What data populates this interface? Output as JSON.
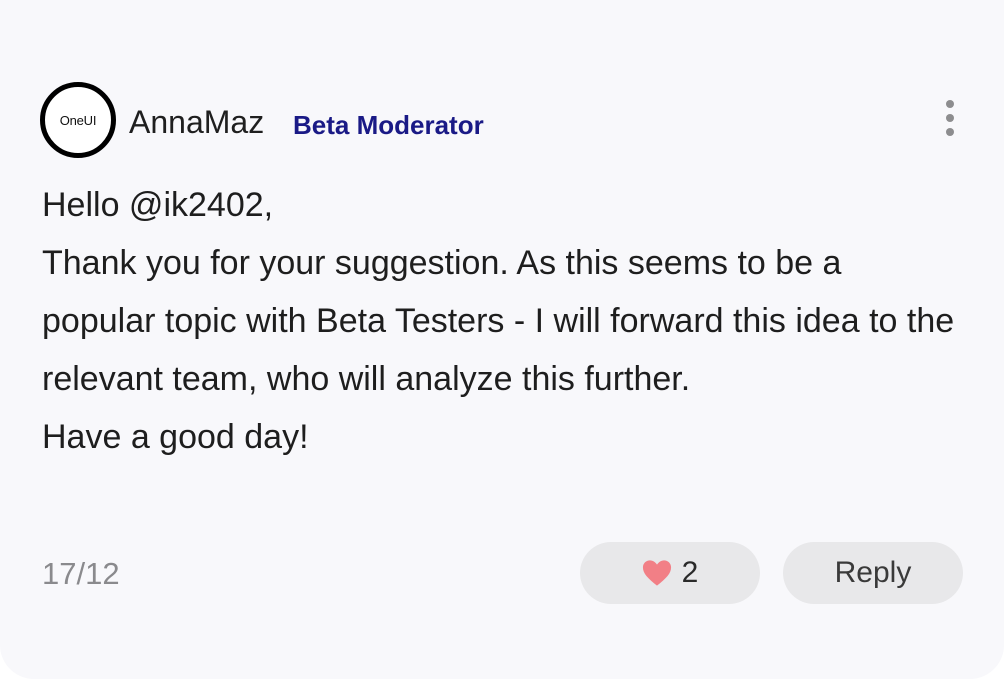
{
  "post": {
    "avatar_text": "OneUI",
    "author": "AnnaMaz",
    "role": "Beta Moderator",
    "message_lines": [
      "Hello @ik2402,",
      "Thank you for your suggestion. As this seems to be a popular topic with Beta Testers - I will forward this idea to the relevant team, who will analyze this further.",
      "Have a good day!"
    ],
    "date": "17/12",
    "likes": "2",
    "reply_label": "Reply"
  },
  "icons": {
    "more": "more-vertical-icon",
    "like": "heart-icon"
  },
  "colors": {
    "role_badge": "#1a1a86",
    "heart": "#f27f86",
    "button_bg": "#e8e8ea",
    "card_bg": "#f8f8fb"
  }
}
